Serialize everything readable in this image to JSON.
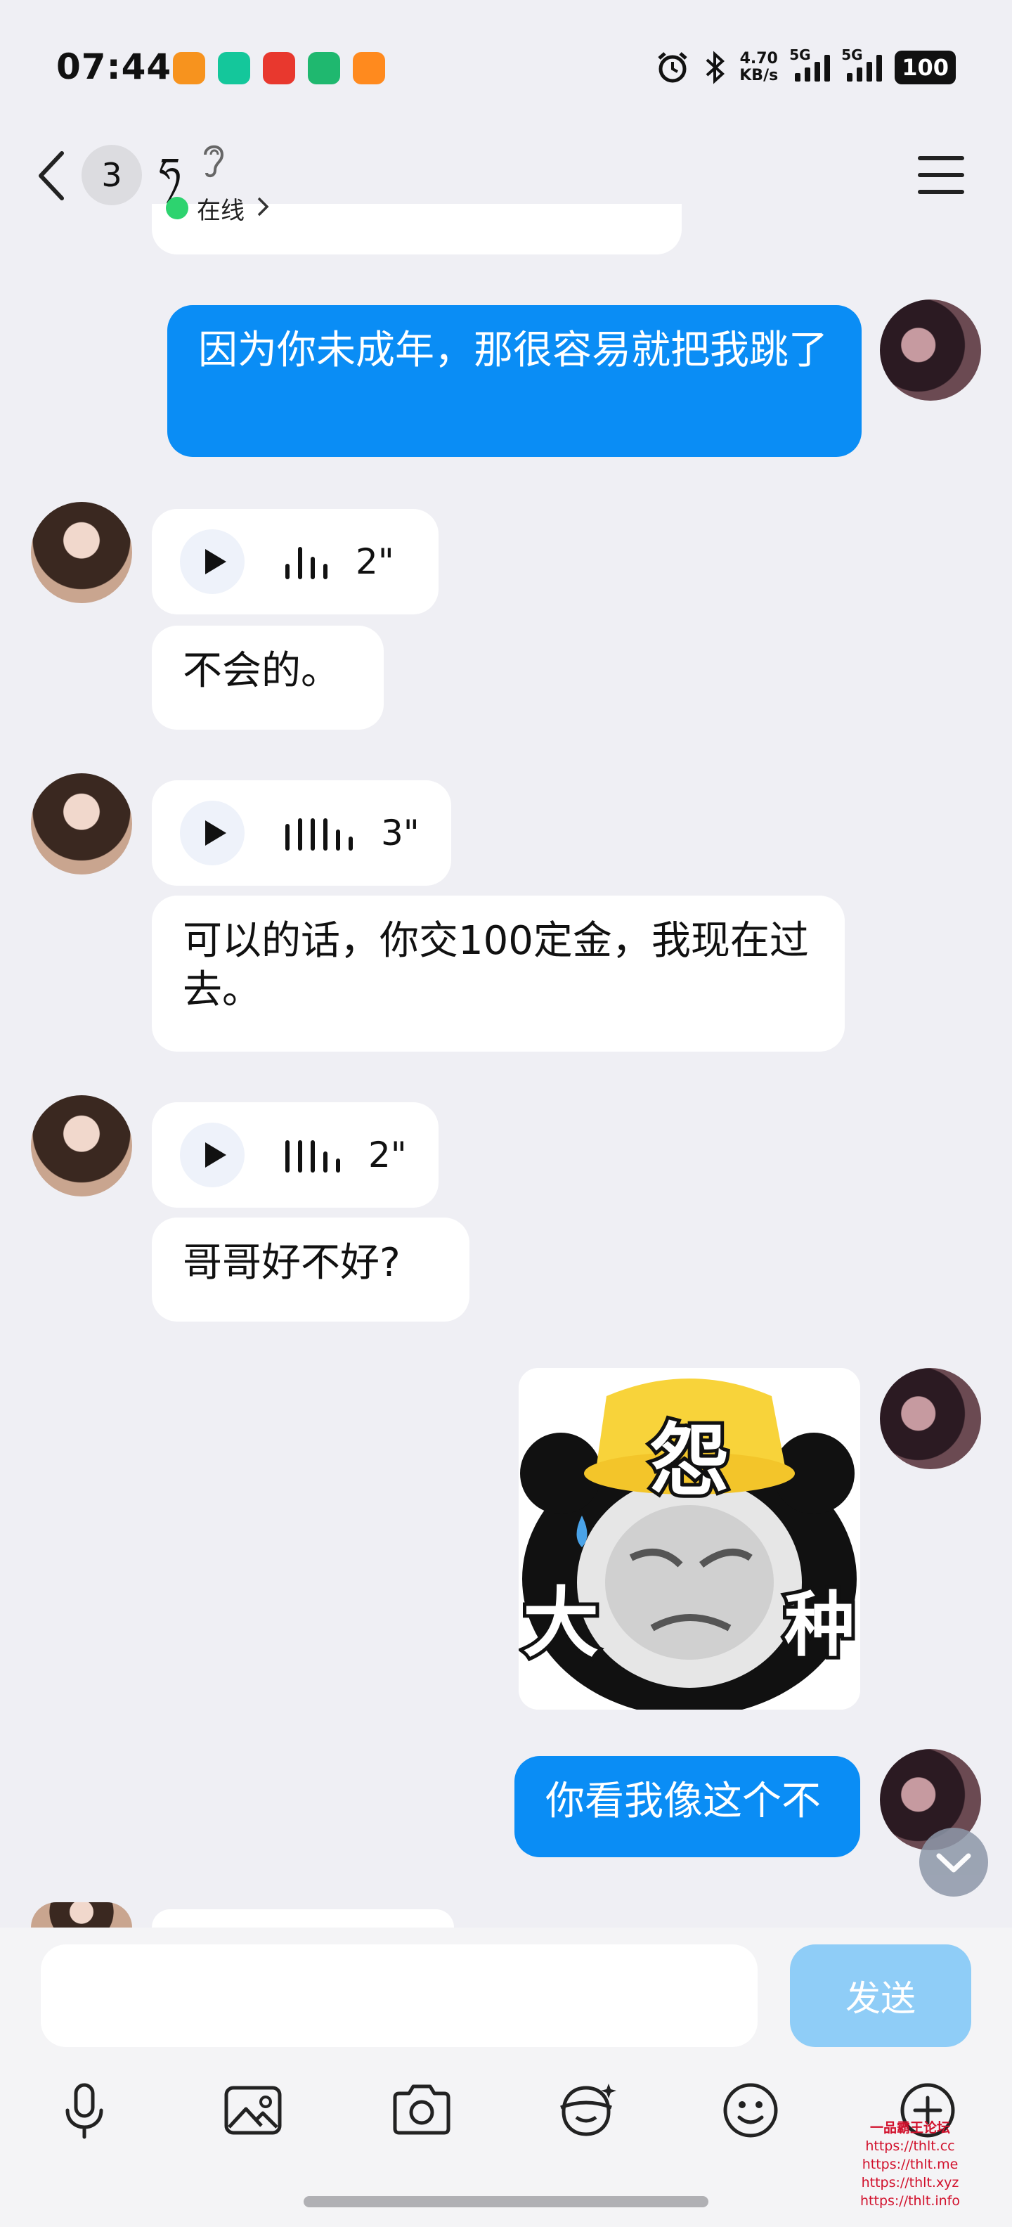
{
  "status_bar": {
    "time": "07:44",
    "net_speed_value": "4.70",
    "net_speed_unit": "KB/s",
    "sim1_label": "5G",
    "sim2_label": "5G",
    "battery": "100",
    "app_icon_colors": [
      "#F7931E",
      "#14C79B",
      "#E8382E",
      "#1FB86F",
      "#FF8A1E"
    ]
  },
  "header": {
    "unread_count": "3",
    "contact_name": "ཧ",
    "status_text": "在线"
  },
  "messages": {
    "m1_text": "因为你未成年，那很容易就把我跳了",
    "m2_voice_duration": "2\"",
    "m3_text": "不会的。",
    "m4_voice_duration": "3\"",
    "m5_text": "可以的话，你交100定金，我现在过去。",
    "m6_voice_duration": "2\"",
    "m7_text": "哥哥好不好?",
    "sticker": {
      "top_char": "怨",
      "left_char": "大",
      "right_char": "种"
    },
    "m8_text": "你看我像这个不"
  },
  "input": {
    "placeholder": "",
    "send_label": "发送"
  },
  "watermark": {
    "title": "一品霸王论坛",
    "urls": [
      "https://thlt.cc",
      "https://thlt.me",
      "https://thlt.xyz",
      "https://thlt.info"
    ]
  },
  "colors": {
    "my_bubble": "#0A8DF5",
    "background": "#EFEFF4",
    "online": "#2DD36F",
    "send_disabled": "#8FCDF7"
  }
}
